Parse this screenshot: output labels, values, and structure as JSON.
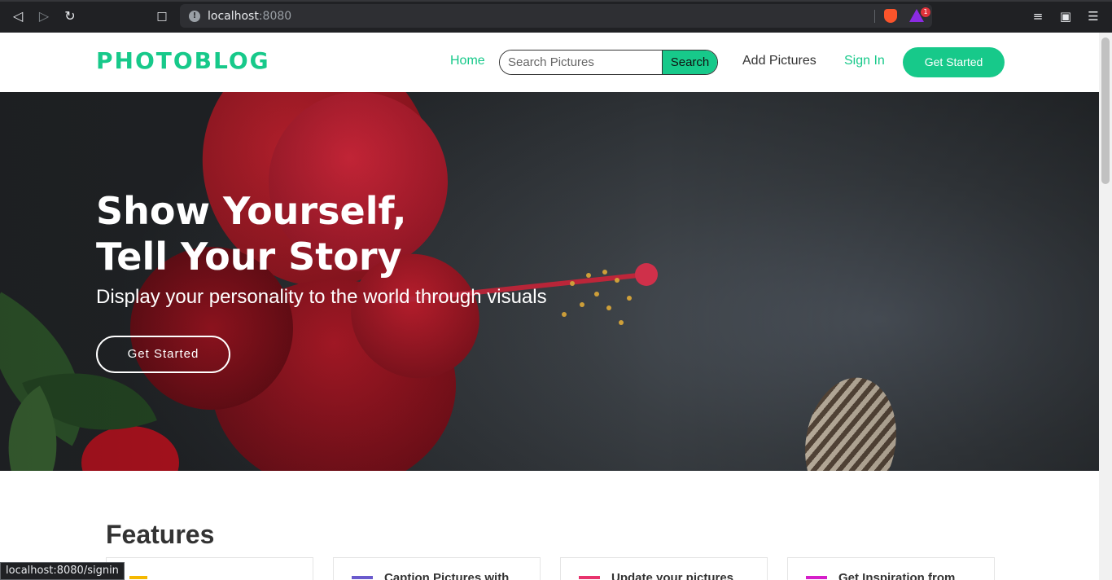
{
  "browser": {
    "url_host": "localhost",
    "url_port": ":8080",
    "rewards_badge": "1",
    "status_url": "localhost:8080/signin"
  },
  "header": {
    "logo": "PHOTOBLOG",
    "nav_home": "Home",
    "search_placeholder": "Search Pictures",
    "search_button": "Search",
    "nav_add": "Add Pictures",
    "nav_signin": "Sign In",
    "nav_cta": "Get Started"
  },
  "hero": {
    "title_line1": "Show Yourself,",
    "title_line2": "Tell Your Story",
    "subtitle": "Display your personality to the world through visuals",
    "cta": "Get Started"
  },
  "features": {
    "heading": "Features",
    "cards": [
      {
        "title": "",
        "icon": "calendar-icon",
        "color": "#f5b800"
      },
      {
        "title": "Caption Pictures with",
        "icon": "caption-icon",
        "color": "#6a5acd"
      },
      {
        "title": "Update your pictures",
        "icon": "calendar-icon",
        "color": "#e8336d"
      },
      {
        "title": "Get Inspiration from",
        "icon": "inspiration-icon",
        "color": "#d61ec9"
      }
    ]
  },
  "colors": {
    "brand": "#17c98a",
    "chrome": "#202124"
  }
}
